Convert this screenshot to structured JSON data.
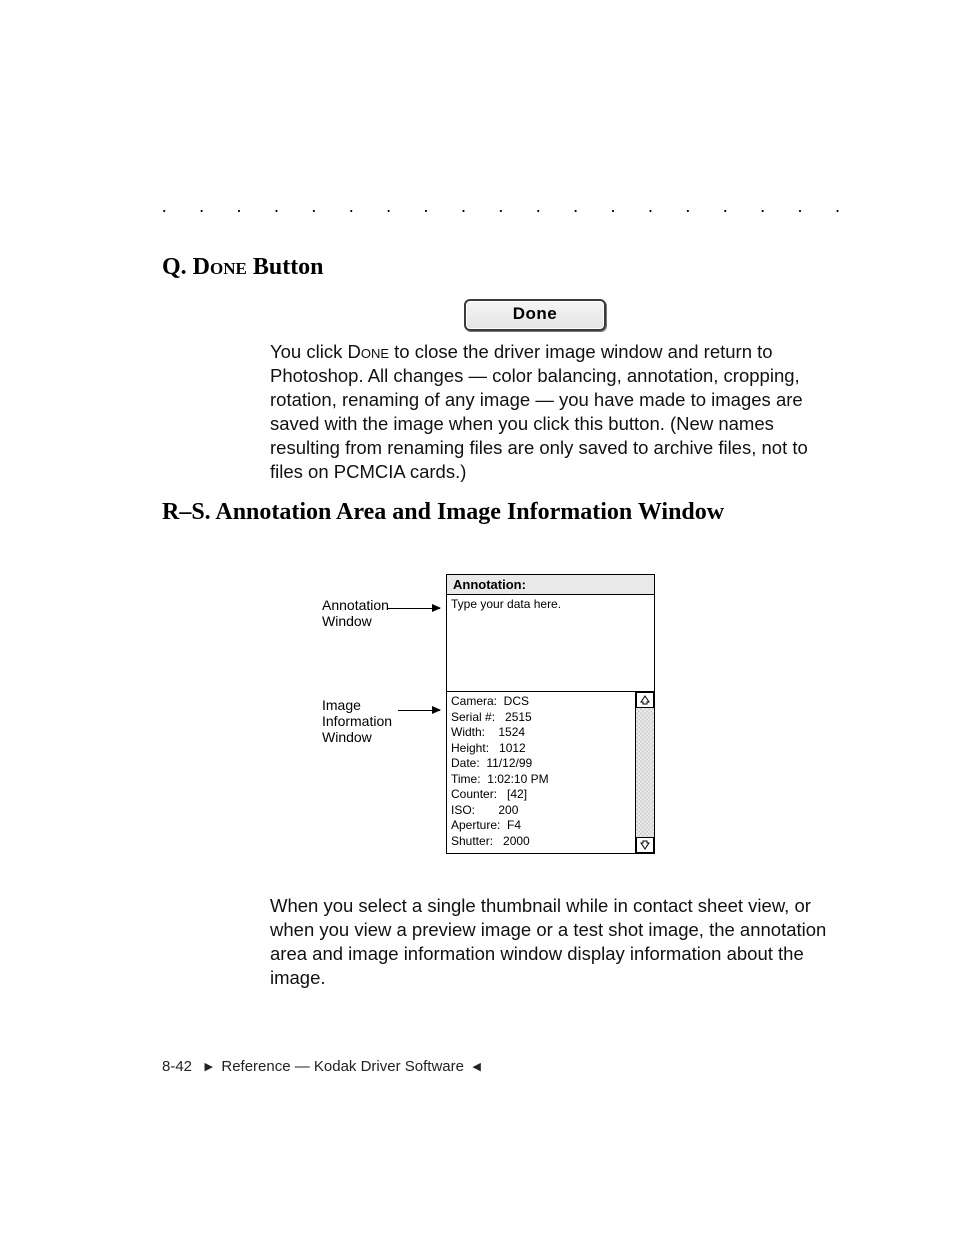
{
  "dots": ". . . . . . . . . . . . . . . . . . . . . . . . . . . . . . . . .",
  "heading_q_prefix": "Q. ",
  "heading_q_done": "Done",
  "heading_q_suffix": " Button",
  "done_button_label": "Done",
  "para_q_a": "You click ",
  "para_q_sc": "Done",
  "para_q_b": " to close the driver image window and return to Photoshop. All changes — color balancing, annotation, cropping, rotation, renaming of any image — you have made to images are saved with the image when you click this button. (New names resulting from renaming files are only saved to archive files, not to files on PCMCIA cards.)",
  "heading_rs": "R–S. Annotation Area and Image Information Window",
  "callout_annotation": "Annotation Window",
  "callout_info": "Image Information Window",
  "fig_title": "Annotation:",
  "fig_annotation_placeholder": "Type your data here.",
  "image_info": {
    "camera": "DCS",
    "serial": "2515",
    "width": "1524",
    "height": "1012",
    "date": "11/12/99",
    "time": "1:02:10 PM",
    "counter": "[42]",
    "iso": "200",
    "aperture": "F4",
    "shutter": "2000"
  },
  "info_lines": "Camera:  DCS\nSerial #:   2515\nWidth:    1524\nHeight:   1012\nDate:  11/12/99\nTime:  1:02:10 PM\nCounter:   [42]\nISO:       200\nAperture:  F4\nShutter:   2000",
  "para_rs": "When you select a single thumbnail while in contact sheet view, or when you view a preview image or a test shot image, the annotation area and image information window display information about the image.",
  "footer_page": "8-42",
  "footer_text": "Reference — Kodak Driver Software"
}
